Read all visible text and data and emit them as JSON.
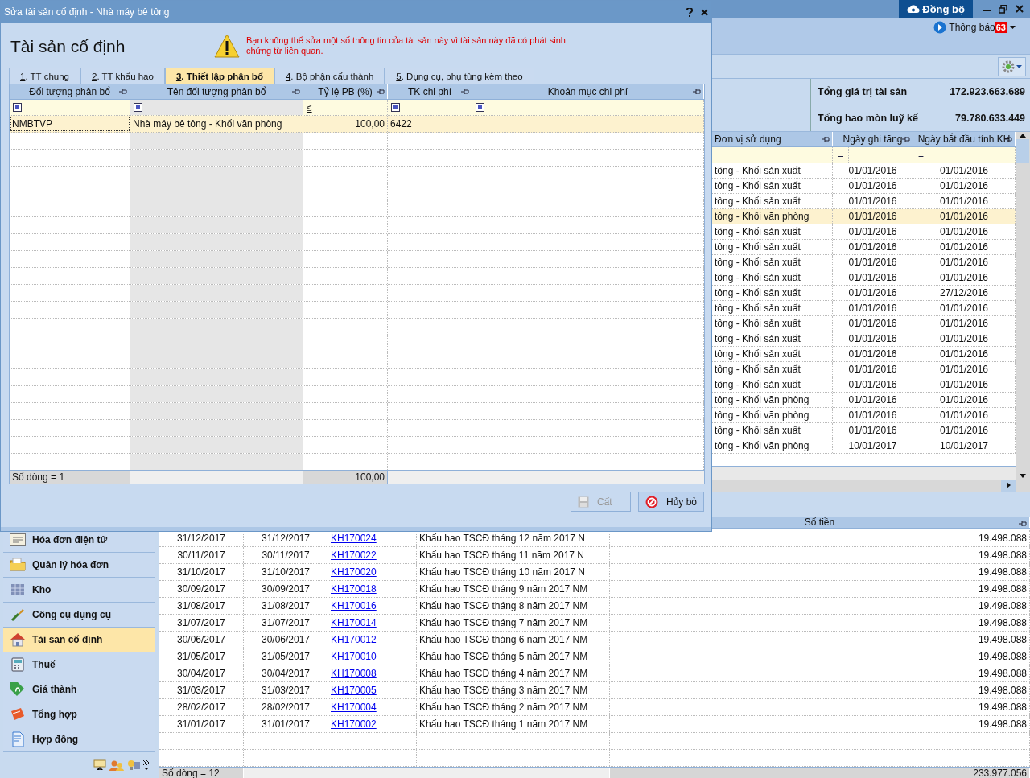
{
  "app": {
    "sync_button": "Đồng bộ",
    "notifications": {
      "label": "Thông báo",
      "badge": "63"
    }
  },
  "summary": [
    {
      "label": "Tổng giá trị tài sản",
      "value": "172.923.663.689"
    },
    {
      "label": "Tổng hao mòn luỹ kế",
      "value": "79.780.633.449"
    }
  ],
  "asset_grid": {
    "columns": [
      {
        "label": "Đơn vị sử dụng"
      },
      {
        "label": "Ngày ghi tăng",
        "filter": "="
      },
      {
        "label": "Ngày bắt đầu tính KH",
        "filter": "="
      }
    ],
    "rows": [
      {
        "unit": "tông - Khối sản xuất",
        "date_added": "01/01/2016",
        "depreciation_start": "01/01/2016",
        "selected": false
      },
      {
        "unit": "tông - Khối sản xuất",
        "date_added": "01/01/2016",
        "depreciation_start": "01/01/2016",
        "selected": false
      },
      {
        "unit": "tông - Khối sản xuất",
        "date_added": "01/01/2016",
        "depreciation_start": "01/01/2016",
        "selected": false
      },
      {
        "unit": "tông - Khối văn phòng",
        "date_added": "01/01/2016",
        "depreciation_start": "01/01/2016",
        "selected": true
      },
      {
        "unit": "tông - Khối sản xuất",
        "date_added": "01/01/2016",
        "depreciation_start": "01/01/2016",
        "selected": false
      },
      {
        "unit": "tông - Khối sản xuất",
        "date_added": "01/01/2016",
        "depreciation_start": "01/01/2016",
        "selected": false
      },
      {
        "unit": "tông - Khối sản xuất",
        "date_added": "01/01/2016",
        "depreciation_start": "01/01/2016",
        "selected": false
      },
      {
        "unit": "tông - Khối sản xuất",
        "date_added": "01/01/2016",
        "depreciation_start": "01/01/2016",
        "selected": false
      },
      {
        "unit": "tông - Khối sản xuất",
        "date_added": "01/01/2016",
        "depreciation_start": "27/12/2016",
        "selected": false
      },
      {
        "unit": "tông - Khối sản xuất",
        "date_added": "01/01/2016",
        "depreciation_start": "01/01/2016",
        "selected": false
      },
      {
        "unit": "tông - Khối sản xuất",
        "date_added": "01/01/2016",
        "depreciation_start": "01/01/2016",
        "selected": false
      },
      {
        "unit": "tông - Khối sản xuất",
        "date_added": "01/01/2016",
        "depreciation_start": "01/01/2016",
        "selected": false
      },
      {
        "unit": "tông - Khối sản xuất",
        "date_added": "01/01/2016",
        "depreciation_start": "01/01/2016",
        "selected": false
      },
      {
        "unit": "tông - Khối sản xuất",
        "date_added": "01/01/2016",
        "depreciation_start": "01/01/2016",
        "selected": false
      },
      {
        "unit": "tông - Khối sản xuất",
        "date_added": "01/01/2016",
        "depreciation_start": "01/01/2016",
        "selected": false
      },
      {
        "unit": "tông - Khối văn phòng",
        "date_added": "01/01/2016",
        "depreciation_start": "01/01/2016",
        "selected": false
      },
      {
        "unit": "tông - Khối văn phòng",
        "date_added": "01/01/2016",
        "depreciation_start": "01/01/2016",
        "selected": false
      },
      {
        "unit": "tông - Khối sản xuất",
        "date_added": "01/01/2016",
        "depreciation_start": "01/01/2016",
        "selected": false
      },
      {
        "unit": "tông - Khối văn phòng",
        "date_added": "10/01/2017",
        "depreciation_start": "10/01/2017",
        "selected": false
      }
    ]
  },
  "sidebar": {
    "items": [
      {
        "label": "Hóa đơn điện tử",
        "selected": false
      },
      {
        "label": "Quản lý hóa đơn",
        "selected": false
      },
      {
        "label": "Kho",
        "selected": false
      },
      {
        "label": "Công cụ dụng cụ",
        "selected": false
      },
      {
        "label": "Tài sản cố định",
        "selected": true
      },
      {
        "label": "Thuế",
        "selected": false
      },
      {
        "label": "Giá thành",
        "selected": false
      },
      {
        "label": "Tổng hợp",
        "selected": false
      },
      {
        "label": "Hợp đồng",
        "selected": false
      }
    ]
  },
  "entries_grid": {
    "columns": [
      {
        "label": "Số tiền"
      }
    ],
    "rows": [
      {
        "date": "31/12/2017",
        "posting_date": "31/12/2017",
        "voucher": "KH170024",
        "description": "Khấu hao TSCĐ tháng 12 năm 2017 N",
        "amount": "19.498.088"
      },
      {
        "date": "30/11/2017",
        "posting_date": "30/11/2017",
        "voucher": "KH170022",
        "description": "Khấu hao TSCĐ tháng 11 năm 2017 N",
        "amount": "19.498.088"
      },
      {
        "date": "31/10/2017",
        "posting_date": "31/10/2017",
        "voucher": "KH170020",
        "description": "Khấu hao TSCĐ tháng 10 năm 2017 N",
        "amount": "19.498.088"
      },
      {
        "date": "30/09/2017",
        "posting_date": "30/09/2017",
        "voucher": "KH170018",
        "description": "Khấu hao TSCĐ tháng 9 năm 2017 NM",
        "amount": "19.498.088"
      },
      {
        "date": "31/08/2017",
        "posting_date": "31/08/2017",
        "voucher": "KH170016",
        "description": "Khấu hao TSCĐ tháng 8 năm 2017 NM",
        "amount": "19.498.088"
      },
      {
        "date": "31/07/2017",
        "posting_date": "31/07/2017",
        "voucher": "KH170014",
        "description": "Khấu hao TSCĐ tháng 7 năm 2017 NM",
        "amount": "19.498.088"
      },
      {
        "date": "30/06/2017",
        "posting_date": "30/06/2017",
        "voucher": "KH170012",
        "description": "Khấu hao TSCĐ tháng 6 năm 2017 NM",
        "amount": "19.498.088"
      },
      {
        "date": "31/05/2017",
        "posting_date": "31/05/2017",
        "voucher": "KH170010",
        "description": "Khấu hao TSCĐ tháng 5 năm 2017 NM",
        "amount": "19.498.088"
      },
      {
        "date": "30/04/2017",
        "posting_date": "30/04/2017",
        "voucher": "KH170008",
        "description": "Khấu hao TSCĐ tháng 4 năm 2017 NM",
        "amount": "19.498.088"
      },
      {
        "date": "31/03/2017",
        "posting_date": "31/03/2017",
        "voucher": "KH170005",
        "description": "Khấu hao TSCĐ tháng 3 năm 2017 NM",
        "amount": "19.498.088"
      },
      {
        "date": "28/02/2017",
        "posting_date": "28/02/2017",
        "voucher": "KH170004",
        "description": "Khấu hao TSCĐ tháng 2 năm 2017 NM",
        "amount": "19.498.088"
      },
      {
        "date": "31/01/2017",
        "posting_date": "31/01/2017",
        "voucher": "KH170002",
        "description": "Khấu hao TSCĐ tháng 1 năm 2017  NM",
        "amount": "19.498.088"
      }
    ],
    "footer": {
      "count": "Số dòng = 12",
      "total": "233.977.056"
    }
  },
  "dialog": {
    "title": "Sửa tài sản cố định - Nhà máy bê tông",
    "heading": "Tài sản cố định",
    "warning": "Bạn không thể sửa một số thông tin của tài sản này vì tài sản này đã có phát sinh chứng từ liên quan.",
    "tabs": [
      {
        "label": "1. TT chung",
        "selected": false
      },
      {
        "label": "2. TT khấu hao",
        "selected": false
      },
      {
        "label": "3. Thiết lập phân bổ",
        "selected": true
      },
      {
        "label": "4. Bộ phận cấu thành",
        "selected": false
      },
      {
        "label": "5. Dụng cụ, phụ tùng kèm theo",
        "selected": false
      }
    ],
    "grid": {
      "columns": [
        {
          "label": "Đối tượng phân bổ",
          "filter": {
            "kind": "mode"
          }
        },
        {
          "label": "Tên đối tượng phân bổ",
          "filter": {
            "kind": "mode"
          }
        },
        {
          "label": "Tỷ lệ PB (%)",
          "filter": {
            "kind": "operator",
            "text": "≤"
          }
        },
        {
          "label": "TK chi phí",
          "filter": {
            "kind": "mode"
          }
        },
        {
          "label": "Khoản mục chi phí",
          "filter": {
            "kind": "mode"
          }
        }
      ],
      "rows": [
        {
          "code": "NMBTVP",
          "name": "Nhà máy bê tông - Khối văn phòng",
          "ratio": "100,00",
          "account": "6422",
          "selected": true
        }
      ],
      "footer": {
        "count": "Số dòng = 1",
        "ratio_total": "100,00"
      }
    },
    "buttons": [
      {
        "label": "Cất",
        "kind": "save",
        "disabled": true
      },
      {
        "label": "Hủy bỏ",
        "kind": "cancel",
        "disabled": false
      }
    ]
  }
}
